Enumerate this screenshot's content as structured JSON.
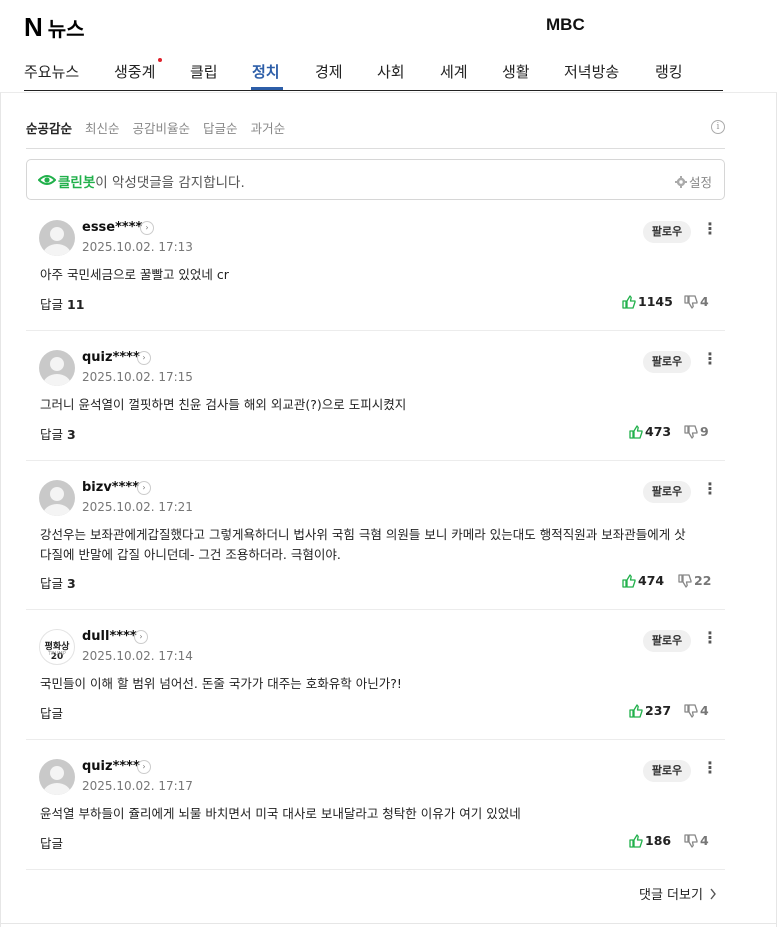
{
  "header": {
    "logo_n": "N",
    "logo_text": "뉴스",
    "press": "MBC"
  },
  "nav": {
    "tabs": [
      "주요뉴스",
      "생중계",
      "클립",
      "정치",
      "경제",
      "사회",
      "세계",
      "생활",
      "저녁방송",
      "랭킹"
    ],
    "active": "정치"
  },
  "sort": {
    "options": [
      "순공감순",
      "최신순",
      "공감비율순",
      "답글순",
      "과거순"
    ],
    "active": "순공감순"
  },
  "cleanbot": {
    "brand": "클린봇",
    "text": "이 악성댓글을 감지합니다.",
    "settings": "설정"
  },
  "comments": [
    {
      "nick": "esse****",
      "date": "2025.10.02. 17:13",
      "text": "아주 국민세금으로 꿀빨고 있었네 cr",
      "reply_label": "답글",
      "reply_count": "11",
      "likes": "1145",
      "dislikes": "4",
      "follow": "팔로우"
    },
    {
      "nick": "quiz****",
      "date": "2025.10.02. 17:15",
      "text": "그러니 윤석열이 껄핏하면 친윤 검사들 해외 외교관(?)으로 도피시켰지",
      "reply_label": "답글",
      "reply_count": "3",
      "likes": "473",
      "dislikes": "9",
      "follow": "팔로우"
    },
    {
      "nick": "bizv****",
      "date": "2025.10.02. 17:21",
      "text_line1": "강선우는 보좌관에게갑질했다고 그렇게욕하더니 법사위 국힘 극혐 의원들 보니 카메라 있는대도 행적직원과 보좌관들에게 삿",
      "text_line2": "다질에 반말에 갑질 아니던데- 그건 조용하더라. 극혐이야.",
      "reply_label": "답글",
      "reply_count": "3",
      "likes": "474",
      "dislikes": "22",
      "follow": "팔로우"
    },
    {
      "nick": "dull****",
      "date": "2025.10.02. 17:14",
      "avatar_text": "평화상20",
      "avatar_subtext": "TRUMP",
      "text": "국민들이 이해 할 범위 넘어선. 돈줄 국가가 대주는 호화유학 아닌가?!",
      "reply_label": "답글",
      "reply_count": "",
      "likes": "237",
      "dislikes": "4",
      "follow": "팔로우"
    },
    {
      "nick": "quiz****",
      "date": "2025.10.02. 17:17",
      "text": "윤석열 부하들이 쥴리에게 뇌물 바치면서 미국 대사로 보내달라고 청탁한 이유가 여기 있었네",
      "reply_label": "답글",
      "reply_count": "",
      "likes": "186",
      "dislikes": "4",
      "follow": "팔로우"
    }
  ],
  "more_comments": "댓글 더보기",
  "colors": {
    "accent": "#2d5ea8",
    "cleanbot": "#21b04b",
    "like": "#21b04b",
    "dot": "#e0222c"
  }
}
